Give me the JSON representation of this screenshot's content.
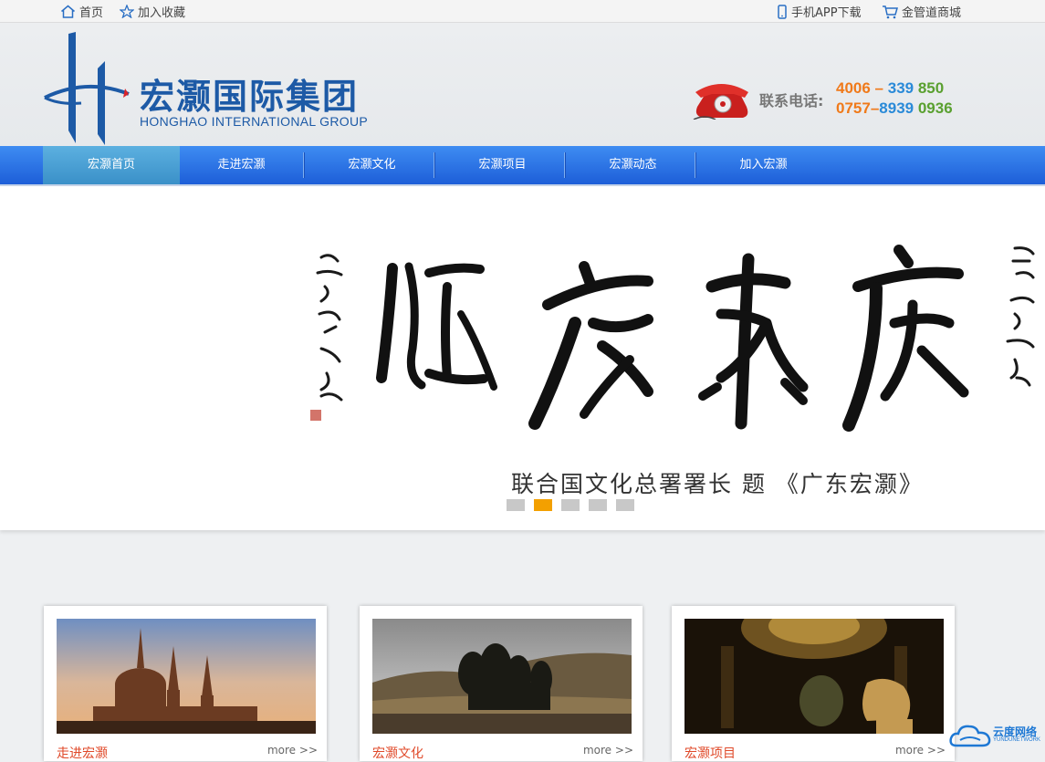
{
  "topbar": {
    "home": "首页",
    "favorite": "加入收藏",
    "app_download": "手机APP下载",
    "mall": "金管道商城"
  },
  "header": {
    "logo_cn": "宏灏国际集团",
    "logo_en": "HONGHAO INTERNATIONAL GROUP",
    "phone_label": "联系电话:",
    "phone_1": "4006 – 339 850",
    "phone_2": "0757–8939 0936",
    "colors": {
      "brand": "#1d5aa6",
      "phone_orange": "#f07a1a",
      "phone_blue": "#2a8ad8",
      "phone_green": "#5aa030"
    }
  },
  "nav": {
    "items": [
      "宏灏首页",
      "走进宏灏",
      "宏灏文化",
      "宏灏项目",
      "宏灏动态",
      "加入宏灏"
    ],
    "active_index": 0
  },
  "banner": {
    "caption": "联合国文化总署署长  题  《广东宏灏》",
    "slide_count": 5,
    "active_slide": 2
  },
  "cards": [
    {
      "title": "走进宏灏",
      "more": "more >>",
      "image": "cathedral-sunset"
    },
    {
      "title": "宏灏文化",
      "more": "more >>",
      "image": "tibetan-landscape"
    },
    {
      "title": "宏灏项目",
      "more": "more >>",
      "image": "basilica-interior-statue"
    }
  ],
  "badge": {
    "title": "云度网络",
    "subtitle": "YUNDUNETWORK"
  }
}
